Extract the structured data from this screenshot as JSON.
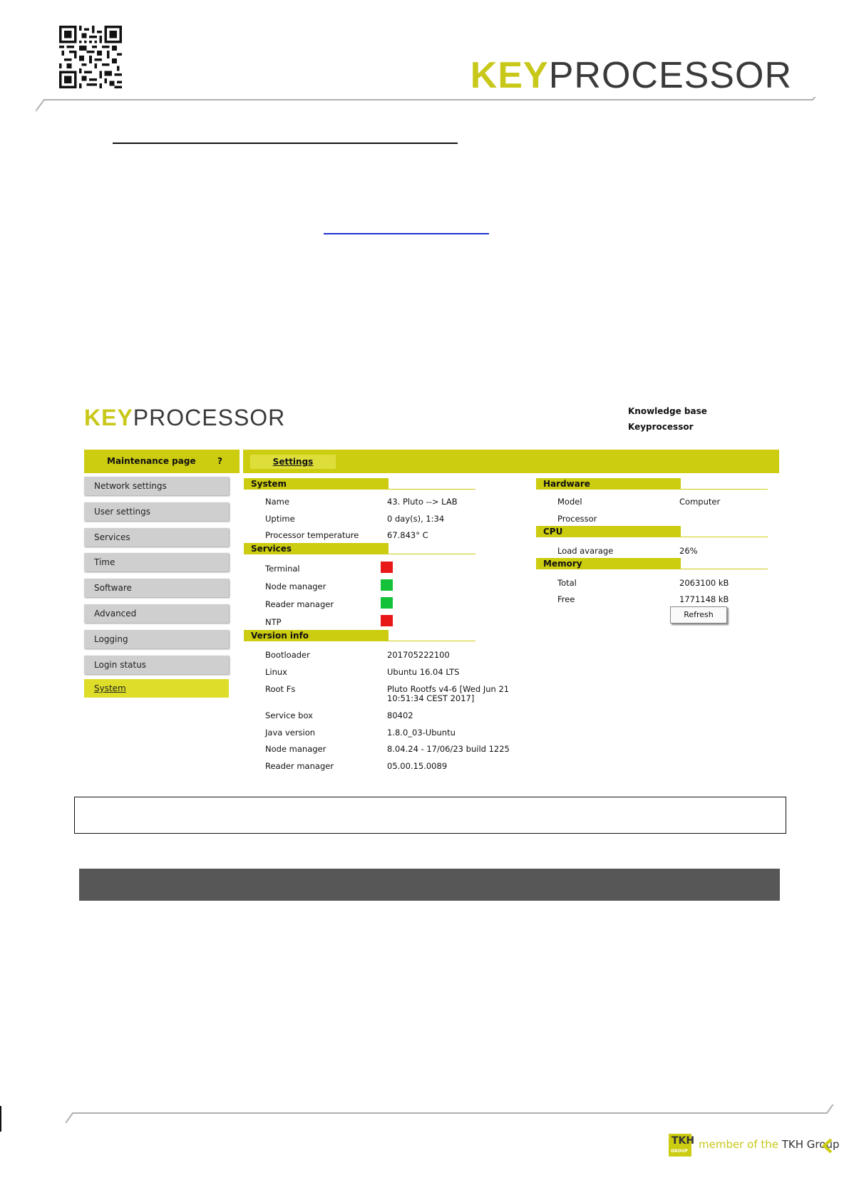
{
  "document": {
    "brand": {
      "key": "KEY",
      "rest": "PROCESSOR"
    },
    "footer": {
      "member_prefix": "member of the",
      "group": "TKH Group",
      "logo_text": "TKH",
      "logo_sub": "GROUP"
    }
  },
  "app": {
    "brand": {
      "key": "KEY",
      "rest": "PROCESSOR"
    },
    "knowledge_base": [
      "Knowledge base",
      "Keyprocessor"
    ],
    "sidebar": {
      "title": "Maintenance page",
      "help": "?",
      "items": [
        {
          "label": "Network settings",
          "active": false
        },
        {
          "label": "User settings",
          "active": false
        },
        {
          "label": "Services",
          "active": false
        },
        {
          "label": "Time",
          "active": false
        },
        {
          "label": "Software",
          "active": false
        },
        {
          "label": "Advanced",
          "active": false
        },
        {
          "label": "Logging",
          "active": false
        },
        {
          "label": "Login status",
          "active": false
        },
        {
          "label": "System",
          "active": true
        }
      ]
    },
    "tab": "Settings",
    "system": {
      "title": "System",
      "rows": [
        {
          "label": "Name",
          "value": "43. Pluto --> LAB"
        },
        {
          "label": "Uptime",
          "value": "0 day(s), 1:34"
        },
        {
          "label": "Processor temperature",
          "value": "67.843° C"
        }
      ]
    },
    "services": {
      "title": "Services",
      "rows": [
        {
          "label": "Terminal",
          "status": "red"
        },
        {
          "label": "Node manager",
          "status": "green"
        },
        {
          "label": "Reader manager",
          "status": "green"
        },
        {
          "label": "NTP",
          "status": "red"
        }
      ]
    },
    "version_info": {
      "title": "Version info",
      "rows": [
        {
          "label": "Bootloader",
          "value": "201705222100"
        },
        {
          "label": "Linux",
          "value": "Ubuntu 16.04 LTS"
        },
        {
          "label": "Root Fs",
          "value": "Pluto Rootfs v4-6 [Wed Jun 21",
          "value2": "10:51:34 CEST 2017]"
        },
        {
          "label": "Service box",
          "value": "80402"
        },
        {
          "label": "Java version",
          "value": "1.8.0_03-Ubuntu"
        },
        {
          "label": "Node manager",
          "value": "8.04.24 - 17/06/23 build 1225"
        },
        {
          "label": "Reader manager",
          "value": "05.00.15.0089"
        }
      ]
    },
    "hardware": {
      "title": "Hardware",
      "rows": [
        {
          "label": "Model",
          "value": "Computer"
        },
        {
          "label": "Processor",
          "value": ""
        }
      ]
    },
    "cpu": {
      "title": "CPU",
      "rows": [
        {
          "label": "Load avarage",
          "value": "26%"
        }
      ]
    },
    "memory": {
      "title": "Memory",
      "rows": [
        {
          "label": "Total",
          "value": "2063100 kB"
        },
        {
          "label": "Free",
          "value": "1771148 kB"
        }
      ]
    },
    "refresh_label": "Refresh",
    "colors": {
      "accent": "#cccc10",
      "status_red": "#e81818",
      "status_green": "#14c23a"
    }
  }
}
